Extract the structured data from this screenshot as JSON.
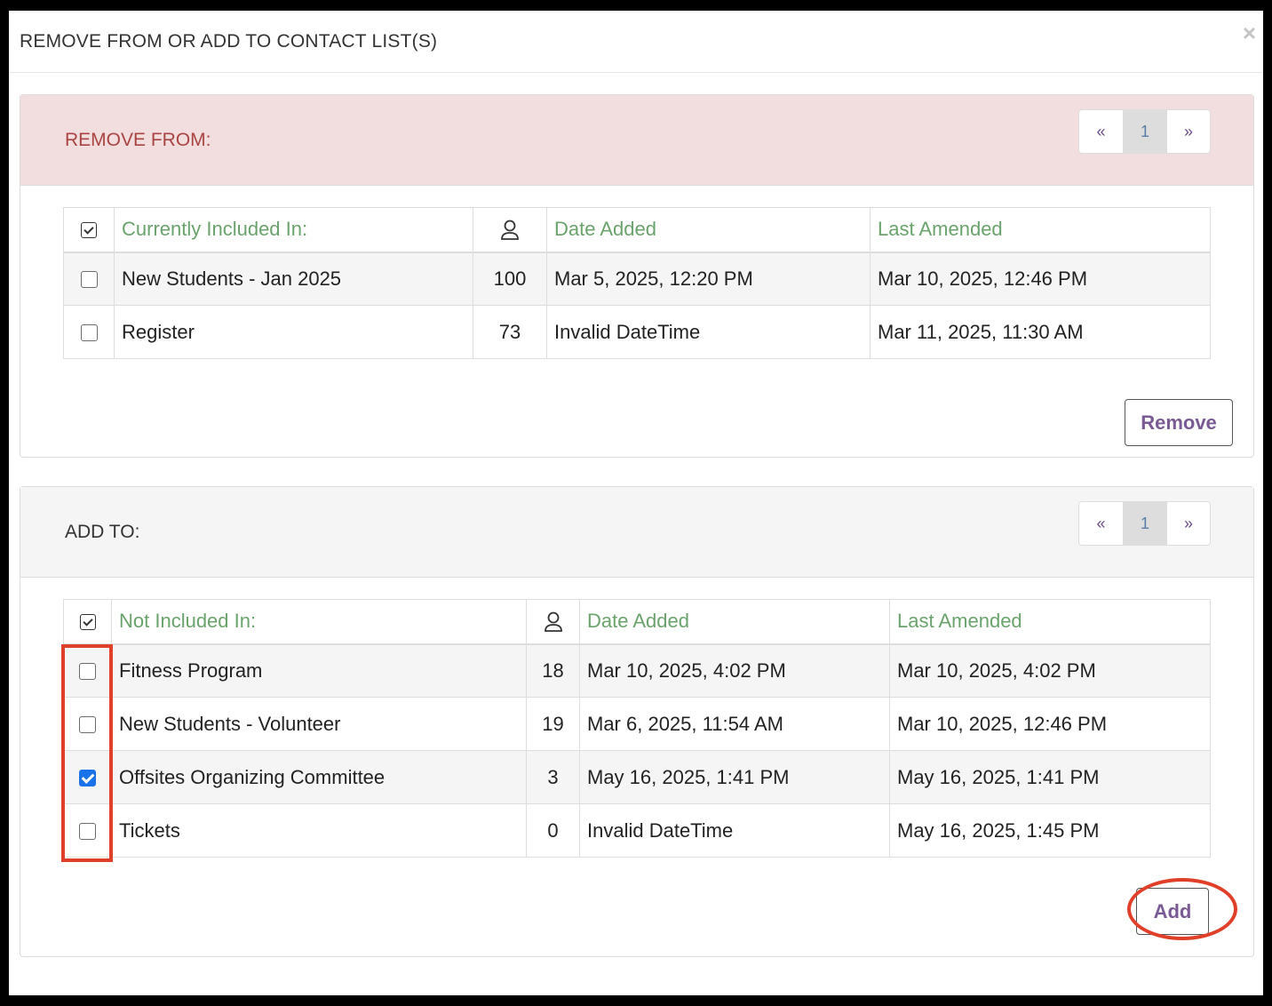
{
  "modal": {
    "title": "REMOVE FROM OR ADD TO CONTACT LIST(S)",
    "close_glyph": "×"
  },
  "remove_panel": {
    "heading": "REMOVE FROM:",
    "pager": {
      "prev": "«",
      "page": "1",
      "next": "»"
    },
    "columns": [
      "Currently Included In:",
      "Date Added",
      "Last Amended"
    ],
    "rows": [
      {
        "name": "New Students - Jan 2025",
        "count": "100",
        "date_added": "Mar 5, 2025, 12:20 PM",
        "last_amended": "Mar 10, 2025, 12:46 PM",
        "checked": false
      },
      {
        "name": "Register",
        "count": "73",
        "date_added": "Invalid DateTime",
        "last_amended": "Mar 11, 2025, 11:30 AM",
        "checked": false
      }
    ],
    "button_label": "Remove"
  },
  "add_panel": {
    "heading": "ADD TO:",
    "pager": {
      "prev": "«",
      "page": "1",
      "next": "»"
    },
    "columns": [
      "Not Included In:",
      "Date Added",
      "Last Amended"
    ],
    "rows": [
      {
        "name": "Fitness Program",
        "count": "18",
        "date_added": "Mar 10, 2025, 4:02 PM",
        "last_amended": "Mar 10, 2025, 4:02 PM",
        "checked": false
      },
      {
        "name": "New Students - Volunteer",
        "count": "19",
        "date_added": "Mar 6, 2025, 11:54 AM",
        "last_amended": "Mar 10, 2025, 12:46 PM",
        "checked": false
      },
      {
        "name": "Offsites Organizing Committee",
        "count": "3",
        "date_added": "May 16, 2025, 1:41 PM",
        "last_amended": "May 16, 2025, 1:41 PM",
        "checked": true
      },
      {
        "name": "Tickets",
        "count": "0",
        "date_added": "Invalid DateTime",
        "last_amended": "May 16, 2025, 1:45 PM",
        "checked": false
      }
    ],
    "button_label": "Add"
  },
  "colors": {
    "remove_heading_bg": "#f2dede",
    "remove_heading_text": "#a94442",
    "column_header_text": "#6aa36b",
    "button_text": "#7a5a94",
    "annotation_red": "#e0402a",
    "checkbox_checked": "#1a73e8"
  },
  "icons": {
    "select_all": "checkbox-checked-icon",
    "member_count": "user-icon",
    "close": "close-icon"
  }
}
